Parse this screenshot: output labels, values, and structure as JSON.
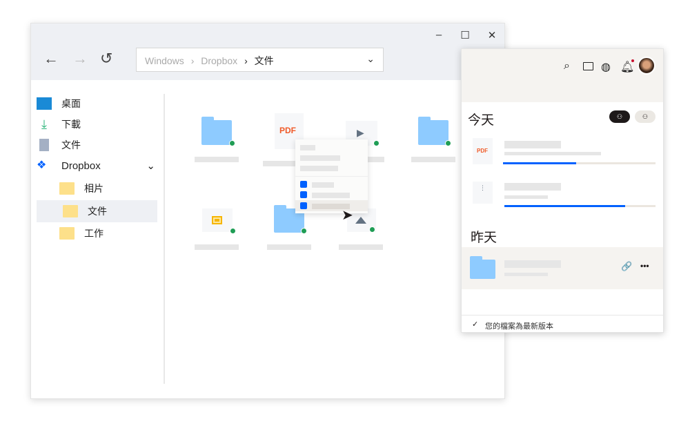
{
  "window": {
    "minimize": "–",
    "maximize": "☐",
    "close": "✕"
  },
  "nav": {
    "back": "←",
    "forward": "→",
    "refresh": "↺"
  },
  "address": {
    "segments": [
      "Windows",
      "Dropbox",
      "文件"
    ],
    "sep": "›",
    "chevron": "⌄"
  },
  "sidebar": {
    "items": [
      {
        "label": "桌面"
      },
      {
        "label": "下載"
      },
      {
        "label": "文件"
      },
      {
        "label": "Dropbox",
        "chevron": "⌄"
      },
      {
        "label": "相片"
      },
      {
        "label": "文件"
      },
      {
        "label": "工作"
      }
    ]
  },
  "files": {
    "pdf_label": "PDF",
    "play": "▶"
  },
  "panel": {
    "today": "今天",
    "yesterday": "昨天",
    "pdf_label": "PDF",
    "status": "您的檔案為最新版本",
    "check": "✓",
    "more": "•••",
    "link": "🔗",
    "progress": [
      0.48,
      0.8
    ]
  }
}
